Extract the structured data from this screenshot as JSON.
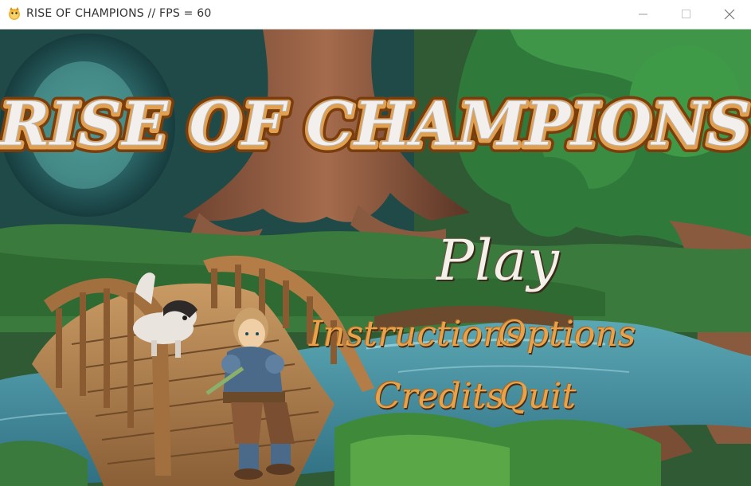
{
  "window": {
    "title": "RISE OF CHAMPIONS // FPS = 60",
    "icon": "python-game-icon",
    "controls": [
      "minimize",
      "maximize",
      "close"
    ]
  },
  "game": {
    "title": "RISE OF CHAMPIONS",
    "menu": {
      "play": "Play",
      "instructions": "Instructions",
      "options": "Options",
      "credits": "Credits",
      "quit": "Quit"
    }
  },
  "colors": {
    "menu_primary": "#f4f0ea",
    "menu_secondary": "#e8a24a",
    "title_fill": "#f2efec",
    "title_outline": "#a8621c"
  }
}
